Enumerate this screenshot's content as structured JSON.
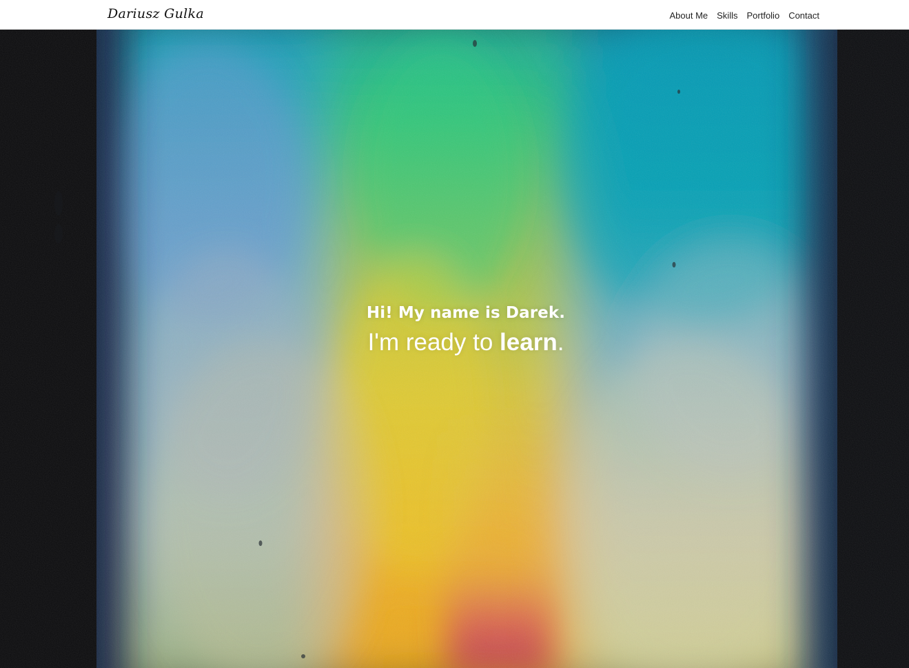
{
  "header": {
    "brand": "Dariusz Gulka",
    "nav": [
      {
        "label": "About Me"
      },
      {
        "label": "Skills"
      },
      {
        "label": "Portfolio"
      },
      {
        "label": "Contact"
      }
    ]
  },
  "hero": {
    "greeting": "Hi! My name is Darek.",
    "tagline_prefix": "I'm ready to ",
    "tagline_accent": "learn",
    "tagline_suffix": ".",
    "background_image": "rainbow-light-spectrum-on-textured-wall"
  },
  "colors": {
    "header_bg": "#ffffff",
    "nav_text": "#222222",
    "hero_text": "#ffffff",
    "hero_edge": "#0c0c0f"
  }
}
